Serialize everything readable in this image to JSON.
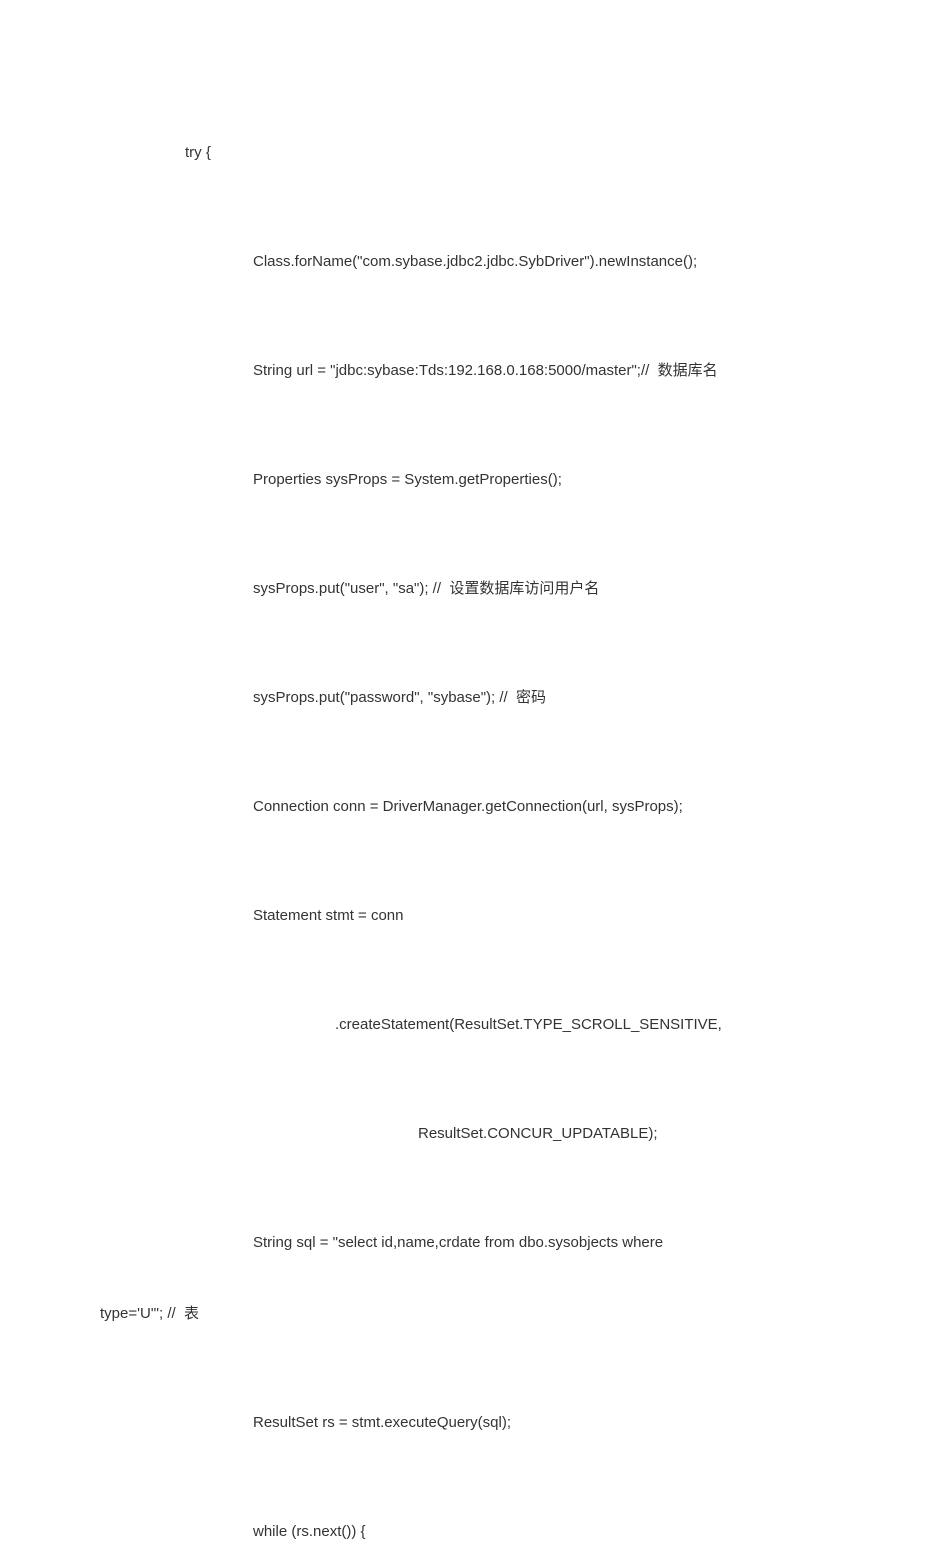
{
  "code": {
    "lines": [
      {
        "indent": "indent-1",
        "text": "try {"
      },
      {
        "indent": "indent-2",
        "text": "Class.forName(\"com.sybase.jdbc2.jdbc.SybDriver\").newInstance();"
      },
      {
        "indent": "indent-2",
        "text": "String url = \"jdbc:sybase:Tds:192.168.0.168:5000/master\";//  数据库名"
      },
      {
        "indent": "indent-2",
        "text": "Properties sysProps = System.getProperties();"
      },
      {
        "indent": "indent-2",
        "text": "sysProps.put(\"user\", \"sa\"); //  设置数据库访问用户名"
      },
      {
        "indent": "indent-2",
        "text": "sysProps.put(\"password\", \"sybase\"); //  密码"
      },
      {
        "indent": "indent-2",
        "text": "Connection conn = DriverManager.getConnection(url, sysProps);"
      },
      {
        "indent": "indent-2",
        "text": "Statement stmt = conn"
      },
      {
        "indent": "indent-3",
        "text": ".createStatement(ResultSet.TYPE_SCROLL_SENSITIVE,"
      },
      {
        "indent": "indent-4",
        "text": "ResultSet.CONCUR_UPDATABLE);"
      },
      {
        "indent": "indent-2",
        "text": "String sql = \"select id,name,crdate from dbo.sysobjects where"
      },
      {
        "indent": "wrap-continue",
        "text": "type='U'\"; //  表"
      },
      {
        "indent": "indent-2",
        "text": "ResultSet rs = stmt.executeQuery(sql);"
      },
      {
        "indent": "indent-2",
        "text": "while (rs.next()) {"
      }
    ]
  }
}
